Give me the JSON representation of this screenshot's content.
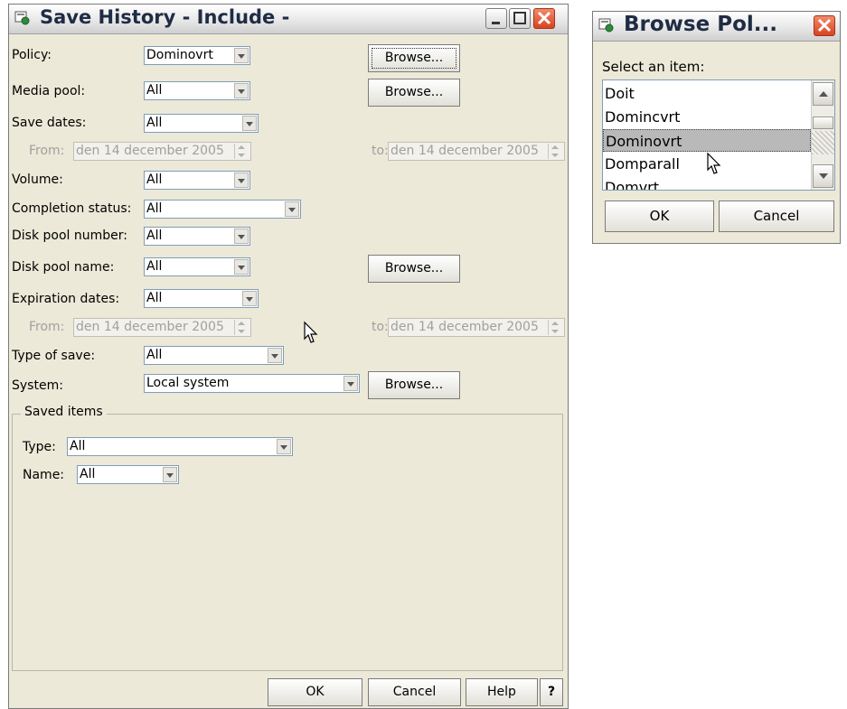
{
  "main_window": {
    "title": "Save History - Include -",
    "fields": {
      "policy": {
        "label": "Policy:",
        "value": "Dominovrt",
        "browse": "Browse..."
      },
      "media_pool": {
        "label": "Media pool:",
        "value": "All",
        "browse": "Browse..."
      },
      "save_dates": {
        "label": "Save dates:",
        "value": "All",
        "from_label": "From:",
        "from_value": "den 14 december 2005",
        "to_label": "to:",
        "to_value": "den 14 december 2005"
      },
      "volume": {
        "label": "Volume:",
        "value": "All"
      },
      "completion_status": {
        "label": "Completion status:",
        "value": "All"
      },
      "disk_pool_number": {
        "label": "Disk pool number:",
        "value": "All"
      },
      "disk_pool_name": {
        "label": "Disk pool name:",
        "value": "All",
        "browse": "Browse..."
      },
      "expiration_dates": {
        "label": "Expiration dates:",
        "value": "All",
        "from_label": "From:",
        "from_value": "den 14 december 2005",
        "to_label": "to:",
        "to_value": "den 14 december 2005"
      },
      "type_of_save": {
        "label": "Type of save:",
        "value": "All"
      },
      "system": {
        "label": "System:",
        "value": "Local system",
        "browse": "Browse..."
      }
    },
    "saved_items": {
      "title": "Saved items",
      "type_label": "Type:",
      "type_value": "All",
      "name_label": "Name:",
      "name_value": "All"
    },
    "buttons": {
      "ok": "OK",
      "cancel": "Cancel",
      "help": "Help",
      "whats_this": "?"
    }
  },
  "browse_dialog": {
    "title": "Browse Pol...",
    "prompt": "Select an item:",
    "items": [
      "Doit",
      "Domincvrt",
      "Dominovrt",
      "Domparall",
      "Domvrt"
    ],
    "selected": "Dominovrt",
    "ok": "OK",
    "cancel": "Cancel"
  },
  "colors": {
    "window_bg": "#ece9d8",
    "title_text": "#1f2c44",
    "close_button": "#d8431f",
    "selection": "#b9b9b9"
  }
}
